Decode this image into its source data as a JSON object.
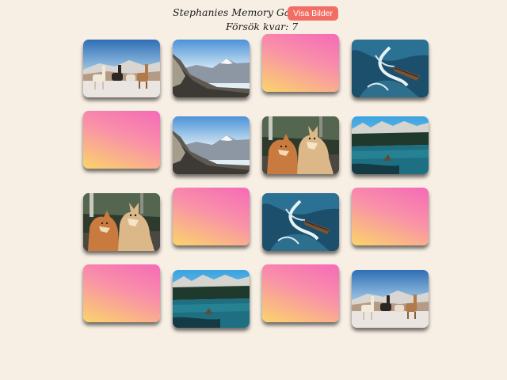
{
  "header": {
    "title": "Stephanies Memory Game",
    "show_button_label": "Visa Bilder",
    "tries_text": "Försök kvar: 7"
  },
  "colors": {
    "background": "#f8efe4",
    "button": "#f26e64",
    "card_back_top": "#f56ab8",
    "card_back_bottom": "#fbd46b"
  },
  "cards": [
    {
      "state": "revealed",
      "image": "llamas"
    },
    {
      "state": "revealed",
      "image": "mountain"
    },
    {
      "state": "hidden",
      "image": ""
    },
    {
      "state": "revealed",
      "image": "ocean"
    },
    {
      "state": "hidden",
      "image": ""
    },
    {
      "state": "revealed",
      "image": "mountain"
    },
    {
      "state": "revealed",
      "image": "wolves"
    },
    {
      "state": "revealed",
      "image": "lake"
    },
    {
      "state": "revealed",
      "image": "wolves"
    },
    {
      "state": "hidden",
      "image": ""
    },
    {
      "state": "revealed",
      "image": "ocean"
    },
    {
      "state": "hidden",
      "image": ""
    },
    {
      "state": "hidden",
      "image": ""
    },
    {
      "state": "revealed",
      "image": "lake"
    },
    {
      "state": "hidden",
      "image": ""
    },
    {
      "state": "revealed",
      "image": "llamas"
    }
  ]
}
